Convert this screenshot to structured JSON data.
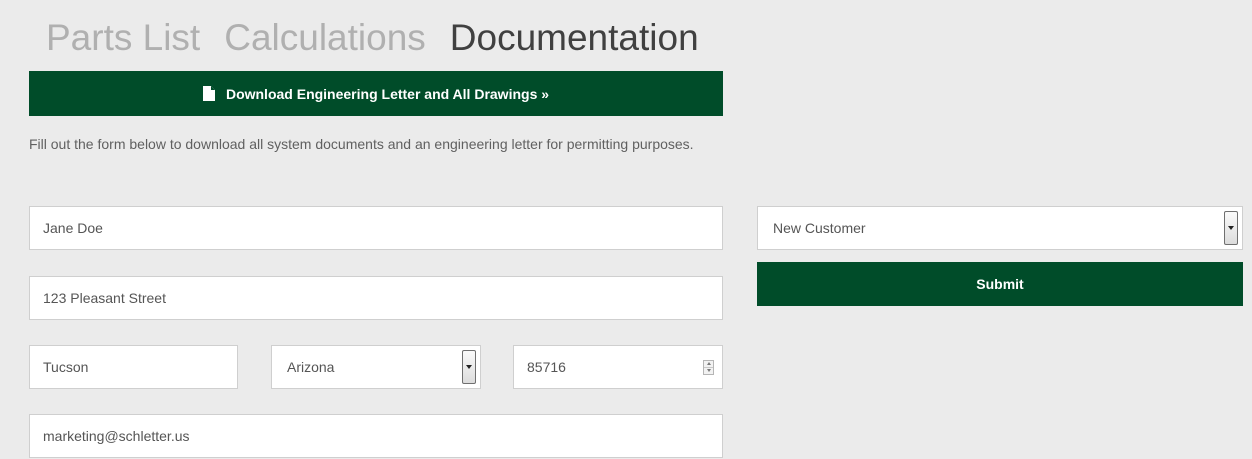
{
  "tabs": [
    {
      "label": "Parts List",
      "active": false
    },
    {
      "label": "Calculations",
      "active": false
    },
    {
      "label": "Documentation",
      "active": true
    }
  ],
  "download": {
    "icon": "document-icon",
    "label": "Download Engineering Letter and All Drawings »"
  },
  "description": "Fill out the form below to download all system documents and an engineering letter for permitting purposes.",
  "form": {
    "name": "Jane Doe",
    "address": "123 Pleasant Street",
    "city": "Tucson",
    "state": "Arizona",
    "zip": "85716",
    "email": "marketing@schletter.us",
    "customer_type": "New Customer",
    "submit_label": "Submit"
  },
  "colors": {
    "brand_green": "#004c29",
    "background": "#ebebeb",
    "tab_inactive": "#b0b0b0",
    "tab_active": "#404040"
  }
}
